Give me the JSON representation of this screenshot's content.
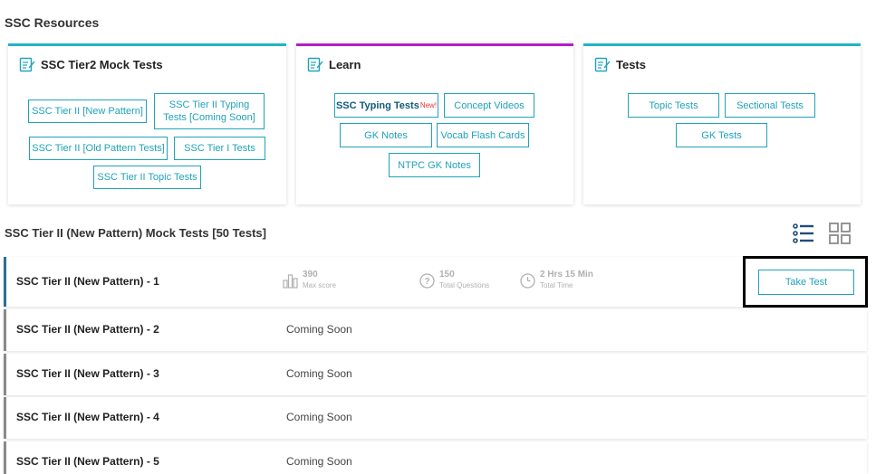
{
  "resources": {
    "title": "SSC Resources",
    "cards": [
      {
        "title": "SSC Tier2 Mock Tests",
        "accent": "#1fb5c9",
        "chips": [
          "SSC Tier II [New Pattern]",
          "SSC Tier II Typing Tests [Coming Soon]",
          "SSC Tier II [Old Pattern Tests]",
          "SSC Tier I Tests",
          "SSC Tier II Topic Tests"
        ]
      },
      {
        "title": "Learn",
        "accent": "#b81ccf",
        "chips": [
          "SSC Typing Tests",
          "Concept Videos",
          "GK Notes",
          "Vocab Flash Cards",
          "NTPC GK Notes"
        ],
        "new_badge": "New!"
      },
      {
        "title": "Tests",
        "accent": "#1fb5c9",
        "chips": [
          "Topic Tests",
          "Sectional Tests",
          "GK Tests"
        ]
      }
    ]
  },
  "mock_tests": {
    "title": "SSC Tier II (New Pattern) Mock Tests [50 Tests]",
    "tests": [
      {
        "name": "SSC Tier II (New Pattern) - 1",
        "max_score": "390",
        "max_score_label": "Max score",
        "questions": "150",
        "questions_label": "Total Questions",
        "time": "2 Hrs 15 Min",
        "time_label": "Total Time",
        "action": "Take Test"
      },
      {
        "name": "SSC Tier II (New Pattern) - 2",
        "status": "Coming Soon"
      },
      {
        "name": "SSC Tier II (New Pattern) - 3",
        "status": "Coming Soon"
      },
      {
        "name": "SSC Tier II (New Pattern) - 4",
        "status": "Coming Soon"
      },
      {
        "name": "SSC Tier II (New Pattern) - 5",
        "status": "Coming Soon"
      }
    ]
  },
  "icons": {
    "card_icon": "edit-note-icon",
    "list_view": "list-view-icon",
    "grid_view": "grid-view-icon",
    "score": "bar-chart-icon",
    "questions": "question-circle-icon",
    "time": "clock-icon"
  },
  "colors": {
    "chip": "#1fa3b9",
    "active_row": "#2a6f98",
    "view_icon_active": "#1e4e7a"
  }
}
